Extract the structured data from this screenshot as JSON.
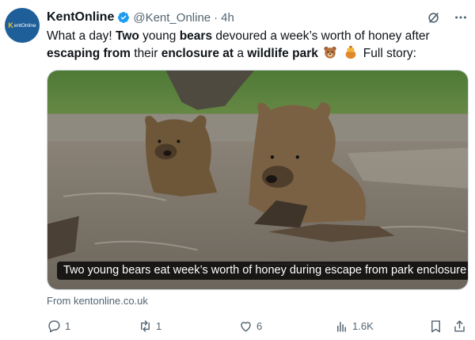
{
  "account": {
    "avatar_text": "KentOnline",
    "avatar_k": "K",
    "avatar_rest": "entOnline",
    "display_name": "KentOnline",
    "handle": "@Kent_Online",
    "separator": "·",
    "time": "4h"
  },
  "tweet": {
    "segments": [
      {
        "text": "What a day! ",
        "bold": false
      },
      {
        "text": "Two",
        "bold": true
      },
      {
        "text": " young ",
        "bold": false
      },
      {
        "text": "bears",
        "bold": true
      },
      {
        "text": " devoured a week’s worth of honey after ",
        "bold": false
      },
      {
        "text": "escaping from",
        "bold": true
      },
      {
        "text": " their ",
        "bold": false
      },
      {
        "text": "enclosure at",
        "bold": true
      },
      {
        "text": " a ",
        "bold": false
      },
      {
        "text": "wildlife park",
        "bold": true
      }
    ],
    "after_emoji": "Full story:",
    "emojis": [
      "bear-face-emoji",
      "honey-pot-emoji"
    ]
  },
  "media": {
    "caption": "Two young bears eat week’s worth of honey during escape from park enclosure",
    "source": "From kentonline.co.uk"
  },
  "actions": {
    "replies": "1",
    "reposts": "1",
    "likes": "6",
    "views": "1.6K"
  },
  "colors": {
    "text": "#0f1419",
    "muted": "#536471",
    "verified": "#1d9bf0",
    "avatar_bg": "#1f5f99"
  }
}
